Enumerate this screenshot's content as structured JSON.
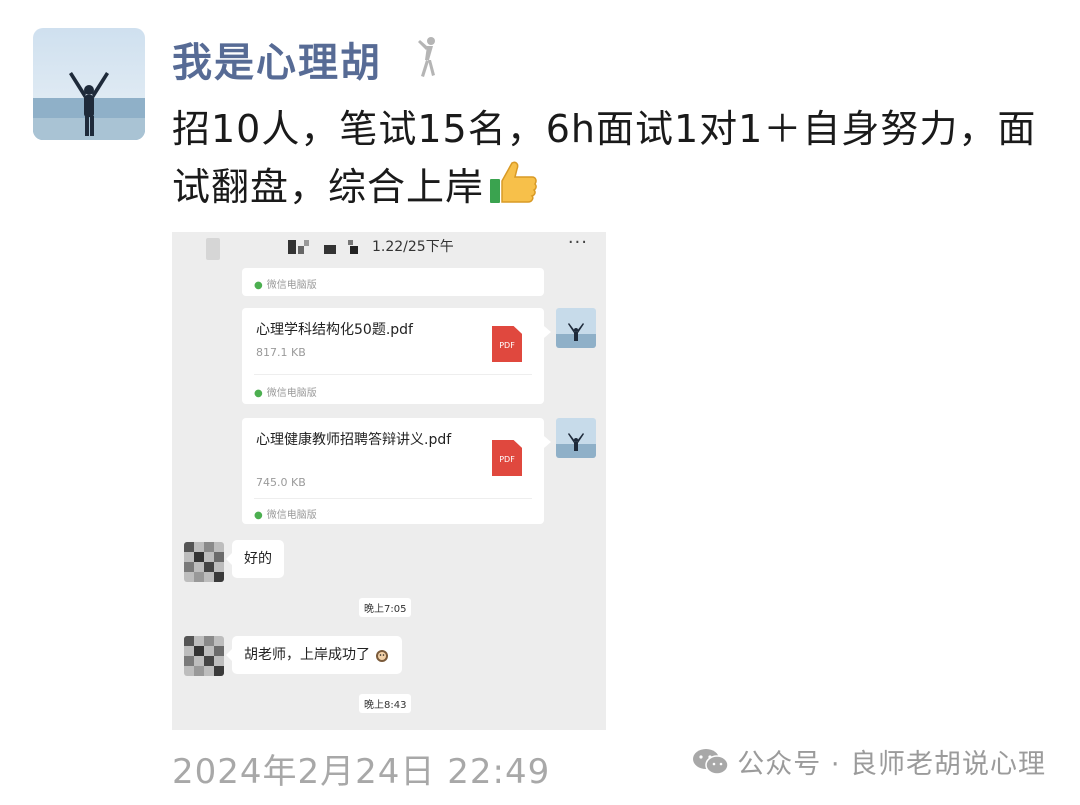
{
  "post": {
    "author": "我是心理胡",
    "text": "招10人，笔试15名，6h面试1对1＋自身努力，面试翻盘，综合上岸",
    "date": "2024年2月24日 22:49"
  },
  "screenshot": {
    "title": "1.22/25下午",
    "more": "···",
    "source_label": "微信电脑版",
    "files": [
      {
        "name": "心理学科结构化50题.pdf",
        "size": "817.1 KB",
        "icon_label": "PDF"
      },
      {
        "name": "心理健康教师招聘答辩讲义.pdf",
        "size": "745.0 KB",
        "icon_label": "PDF"
      }
    ],
    "messages": [
      {
        "text": "好的",
        "time": "晚上7:05"
      },
      {
        "text": "胡老师，上岸成功了",
        "time": "晚上8:43"
      }
    ]
  },
  "watermark": {
    "text": "公众号 · 良师老胡说心理"
  },
  "colors": {
    "author": "#576b95",
    "chat_bg": "#ededed",
    "pdf_icon": "#e0483e",
    "meta_text": "#a8a8a8"
  },
  "icons": [
    "thumbs-up-icon",
    "pdf-file-icon",
    "wechat-icon",
    "more-icon",
    "figure-tag-icon"
  ]
}
